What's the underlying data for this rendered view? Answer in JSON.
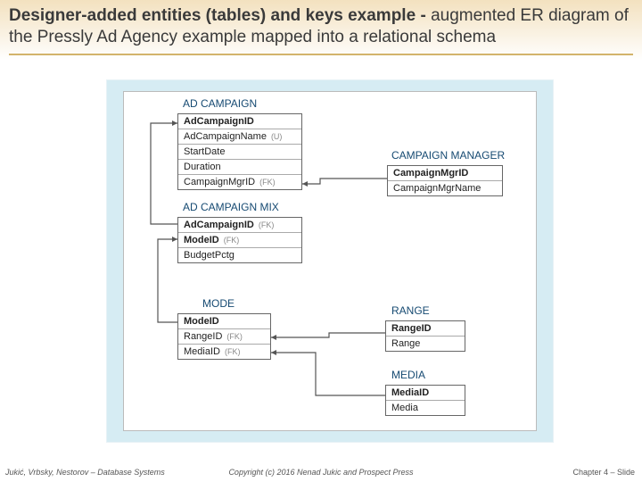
{
  "slide": {
    "title_bold": "Designer-added entities (tables) and keys example",
    "title_sep": "  -  ",
    "title_rest": "augmented ER diagram of the Pressly Ad Agency example mapped into a relational schema"
  },
  "tables": {
    "ad_campaign": {
      "label": "AD CAMPAIGN",
      "rows": [
        {
          "name": "AdCampaignID",
          "bold": true,
          "ann": ""
        },
        {
          "name": "AdCampaignName",
          "bold": false,
          "ann": "(U)"
        },
        {
          "name": "StartDate",
          "bold": false,
          "ann": ""
        },
        {
          "name": "Duration",
          "bold": false,
          "ann": ""
        },
        {
          "name": "CampaignMgrID",
          "bold": false,
          "ann": "(FK)"
        }
      ]
    },
    "campaign_manager": {
      "label": "CAMPAIGN MANAGER",
      "rows": [
        {
          "name": "CampaignMgrID",
          "bold": true,
          "ann": ""
        },
        {
          "name": "CampaignMgrName",
          "bold": false,
          "ann": ""
        }
      ]
    },
    "ad_campaign_mix": {
      "label": "AD CAMPAIGN MIX",
      "rows": [
        {
          "name": "AdCampaignID",
          "bold": true,
          "ann": "(FK)"
        },
        {
          "name": "ModeID",
          "bold": true,
          "ann": "(FK)"
        },
        {
          "name": "BudgetPctg",
          "bold": false,
          "ann": ""
        }
      ]
    },
    "mode": {
      "label": "MODE",
      "rows": [
        {
          "name": "ModeID",
          "bold": true,
          "ann": ""
        },
        {
          "name": "RangeID",
          "bold": false,
          "ann": "(FK)"
        },
        {
          "name": "MediaID",
          "bold": false,
          "ann": "(FK)"
        }
      ]
    },
    "range": {
      "label": "RANGE",
      "rows": [
        {
          "name": "RangeID",
          "bold": true,
          "ann": ""
        },
        {
          "name": "Range",
          "bold": false,
          "ann": ""
        }
      ]
    },
    "media": {
      "label": "MEDIA",
      "rows": [
        {
          "name": "MediaID",
          "bold": true,
          "ann": ""
        },
        {
          "name": "Media",
          "bold": false,
          "ann": ""
        }
      ]
    }
  },
  "footer": {
    "left": "Jukić, Vrbsky, Nestorov – Database Systems",
    "center": "Copyright (c) 2016 Nenad Jukic and Prospect Press",
    "right": "Chapter 4 – Slide"
  }
}
